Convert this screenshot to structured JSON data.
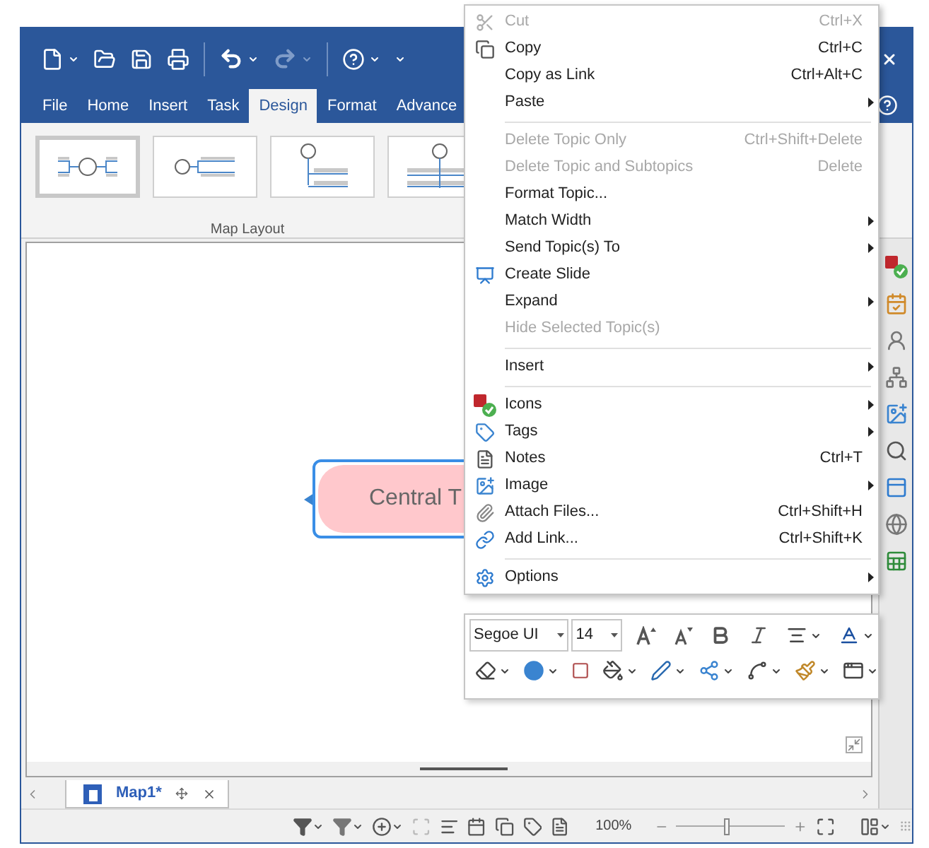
{
  "ribbon_tabs": [
    {
      "label": "File",
      "selected": false
    },
    {
      "label": "Home",
      "selected": false
    },
    {
      "label": "Insert",
      "selected": false
    },
    {
      "label": "Task",
      "selected": false
    },
    {
      "label": "Design",
      "selected": true
    },
    {
      "label": "Format",
      "selected": false
    },
    {
      "label": "Advance",
      "selected": false
    }
  ],
  "ribbon_group": {
    "label": "Map Layout",
    "layouts": [
      {
        "selected": true
      },
      {
        "selected": false
      },
      {
        "selected": false
      },
      {
        "selected": false
      }
    ]
  },
  "canvas": {
    "central_topic": {
      "label": "Central T",
      "selected": true
    }
  },
  "document_tabs": [
    {
      "label": "Map1*",
      "selected": true
    }
  ],
  "status_bar": {
    "zoom": "100%",
    "zoom_slider": {
      "level": 0.47
    }
  },
  "context_menu": [
    {
      "kind": "item",
      "label": "Cut",
      "shortcut": "Ctrl+X",
      "disabled": true,
      "submenu": false
    },
    {
      "kind": "item",
      "label": "Copy",
      "shortcut": "Ctrl+C",
      "disabled": false,
      "submenu": false
    },
    {
      "kind": "item",
      "label": "Copy as Link",
      "shortcut": "Ctrl+Alt+C",
      "disabled": false,
      "submenu": false
    },
    {
      "kind": "item",
      "label": "Paste",
      "disabled": false,
      "submenu": true
    },
    {
      "kind": "separator"
    },
    {
      "kind": "item",
      "label": "Delete Topic Only",
      "shortcut": "Ctrl+Shift+Delete",
      "disabled": true,
      "submenu": false
    },
    {
      "kind": "item",
      "label": "Delete Topic and Subtopics",
      "shortcut": "Delete",
      "disabled": true,
      "submenu": false
    },
    {
      "kind": "item",
      "label": "Format Topic...",
      "disabled": false,
      "submenu": false
    },
    {
      "kind": "item",
      "label": "Match Width",
      "disabled": false,
      "submenu": true
    },
    {
      "kind": "item",
      "label": "Send Topic(s) To",
      "disabled": false,
      "submenu": true
    },
    {
      "kind": "item",
      "label": "Create Slide",
      "disabled": false,
      "submenu": false
    },
    {
      "kind": "item",
      "label": "Expand",
      "disabled": false,
      "submenu": true
    },
    {
      "kind": "item",
      "label": "Hide Selected Topic(s)",
      "disabled": true,
      "submenu": false
    },
    {
      "kind": "separator"
    },
    {
      "kind": "item",
      "label": "Insert",
      "disabled": false,
      "submenu": true
    },
    {
      "kind": "separator"
    },
    {
      "kind": "item",
      "label": "Icons",
      "disabled": false,
      "submenu": true
    },
    {
      "kind": "item",
      "label": "Tags",
      "disabled": false,
      "submenu": true
    },
    {
      "kind": "item",
      "label": "Notes",
      "shortcut": "Ctrl+T",
      "disabled": false,
      "submenu": false
    },
    {
      "kind": "item",
      "label": "Image",
      "disabled": false,
      "submenu": true
    },
    {
      "kind": "item",
      "label": "Attach Files...",
      "shortcut": "Ctrl+Shift+H",
      "disabled": false,
      "submenu": false
    },
    {
      "kind": "item",
      "label": "Add Link...",
      "shortcut": "Ctrl+Shift+K",
      "disabled": false,
      "submenu": false
    },
    {
      "kind": "separator"
    },
    {
      "kind": "item",
      "label": "Options",
      "disabled": false,
      "submenu": true
    }
  ],
  "mini_toolbar": {
    "font": "Segoe UI",
    "size": "14"
  }
}
